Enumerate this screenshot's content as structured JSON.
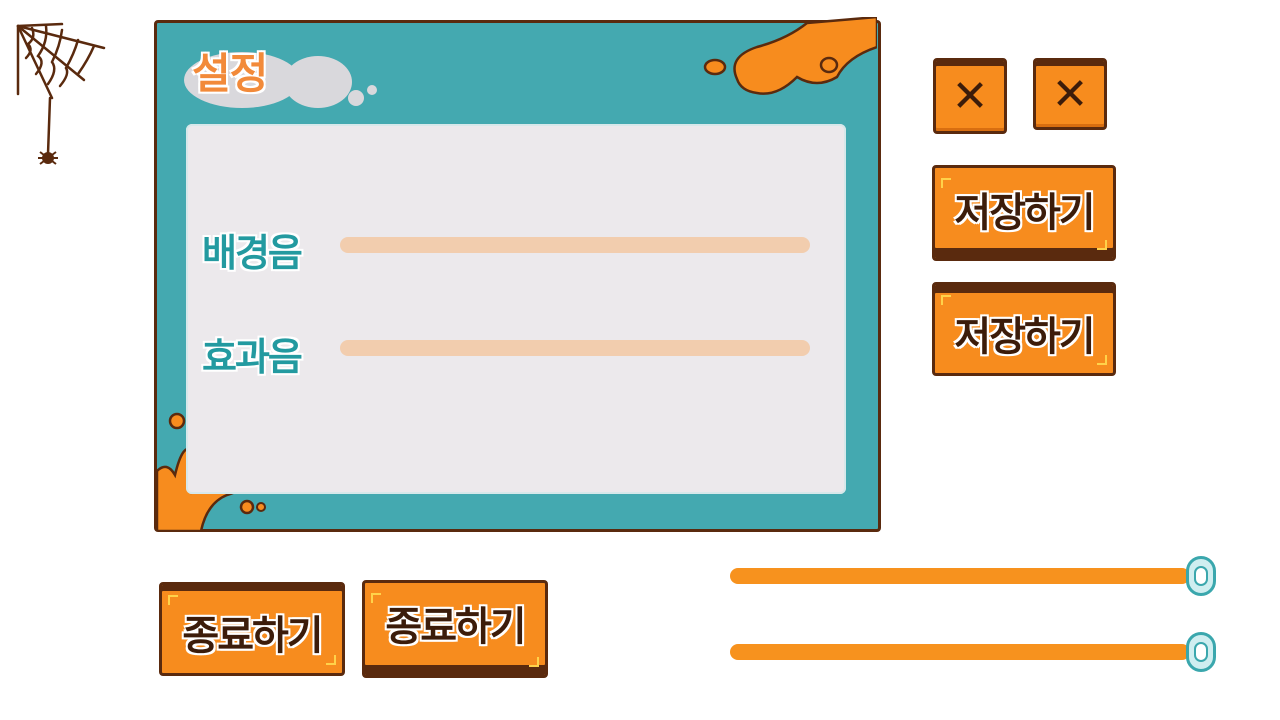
{
  "settings_panel": {
    "title": "설정",
    "rows": [
      {
        "label": "배경음"
      },
      {
        "label": "효과음"
      }
    ]
  },
  "close_buttons": [
    "✕",
    "✕"
  ],
  "save_buttons": [
    "저장하기",
    "저장하기"
  ],
  "exit_buttons": [
    "종료하기",
    "종료하기"
  ],
  "sliders": [
    {
      "value": 1.0
    },
    {
      "value": 1.0
    }
  ],
  "colors": {
    "panel": "#44a9b0",
    "button": "#f78c1e",
    "outline": "#5a2a0e",
    "title": "#f28a3a",
    "label": "#239aa0"
  }
}
